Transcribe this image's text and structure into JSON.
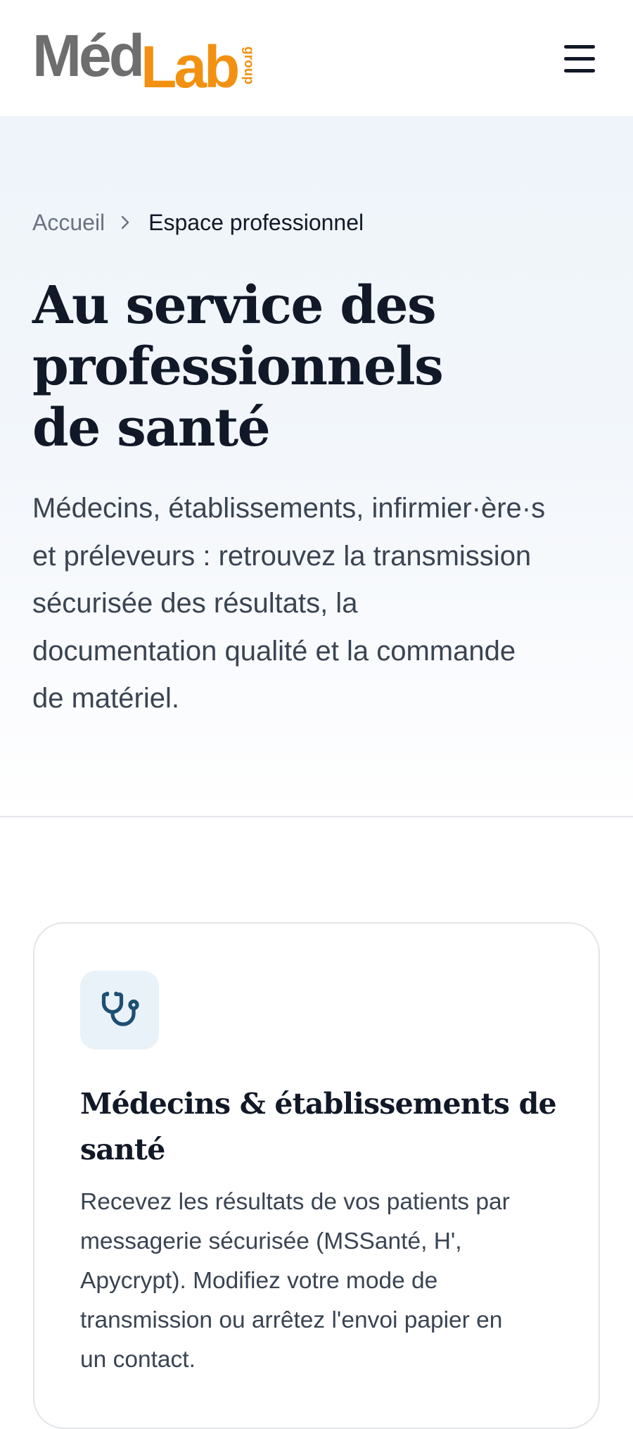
{
  "header": {
    "logo": {
      "part1": "Méd",
      "part2": "Lab",
      "suffix": "group"
    },
    "menu_icon": "hamburger-menu-icon"
  },
  "breadcrumb": {
    "home": "Accueil",
    "separator_icon": "chevron-right-icon",
    "current": "Espace professionnel"
  },
  "hero": {
    "title_lines": [
      "Au service des",
      "professionnels",
      "de santé"
    ],
    "description_lines": [
      "Médecins, établissements, infirmier·ère·s",
      "et préleveurs : retrouvez la transmission",
      "sécurisée des résultats, la",
      "documentation qualité et la commande",
      "de matériel."
    ]
  },
  "cards": [
    {
      "icon": "stethoscope-icon",
      "title_lines": [
        "Médecins & établissements de",
        "santé"
      ],
      "description_lines": [
        "Recevez les résultats de vos patients par",
        "messagerie sécurisée (MSSanté, H',",
        "Apycrypt). Modifiez votre mode de",
        "transmission ou arrêtez l'envoi papier en",
        "un contact."
      ]
    }
  ],
  "colors": {
    "brand_gray": "#6e6e6e",
    "brand_orange": "#f29111",
    "icon_blue": "#1d4f73",
    "hero_bg": "#eef4fa"
  }
}
